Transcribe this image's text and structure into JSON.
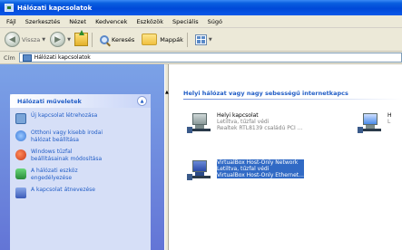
{
  "window": {
    "title": "Hálózati kapcsolatok"
  },
  "menu": [
    "Fájl",
    "Szerkesztés",
    "Nézet",
    "Kedvencek",
    "Eszközök",
    "Speciális",
    "Súgó"
  ],
  "toolbar": {
    "back_label": "Vissza",
    "search_label": "Keresés",
    "folders_label": "Mappák"
  },
  "address": {
    "label": "Cím",
    "value": "Hálózati kapcsolatok"
  },
  "tasks_panel": {
    "title": "Hálózati műveletek",
    "items": [
      {
        "label": "Új kapcsolat létrehozása",
        "icon": "new-connection-icon",
        "color": "#7aa5d8"
      },
      {
        "label": "Otthoni vagy kisebb irodai hálózat beállítása",
        "icon": "home-network-icon",
        "color": "#3a7ad8"
      },
      {
        "label": "Windows tűzfal beállításainak módosítása",
        "icon": "firewall-icon",
        "color": "#c83a1a"
      },
      {
        "label": "A hálózati eszköz engedélyezése",
        "icon": "enable-device-icon",
        "color": "#2a8a3a"
      },
      {
        "label": "A kapcsolat átnevezése",
        "icon": "rename-icon",
        "color": "#3a5ab8"
      }
    ]
  },
  "content": {
    "group_header": "Helyi hálózat vagy nagy sebességű internetkapcs",
    "connections": [
      {
        "name": "Helyi kapcsolat",
        "status": "Letiltva, tűzfal védi",
        "device": "Realtek RTL8139 családú PCI ...",
        "selected": false
      },
      {
        "name": "H",
        "status": "L",
        "device": "",
        "selected": false
      },
      {
        "name": "VirtualBox Host-Only Network",
        "status": "Letiltva, tűzfal védi",
        "device": "VirtualBox Host-Only Ethernet...",
        "selected": true
      }
    ]
  }
}
